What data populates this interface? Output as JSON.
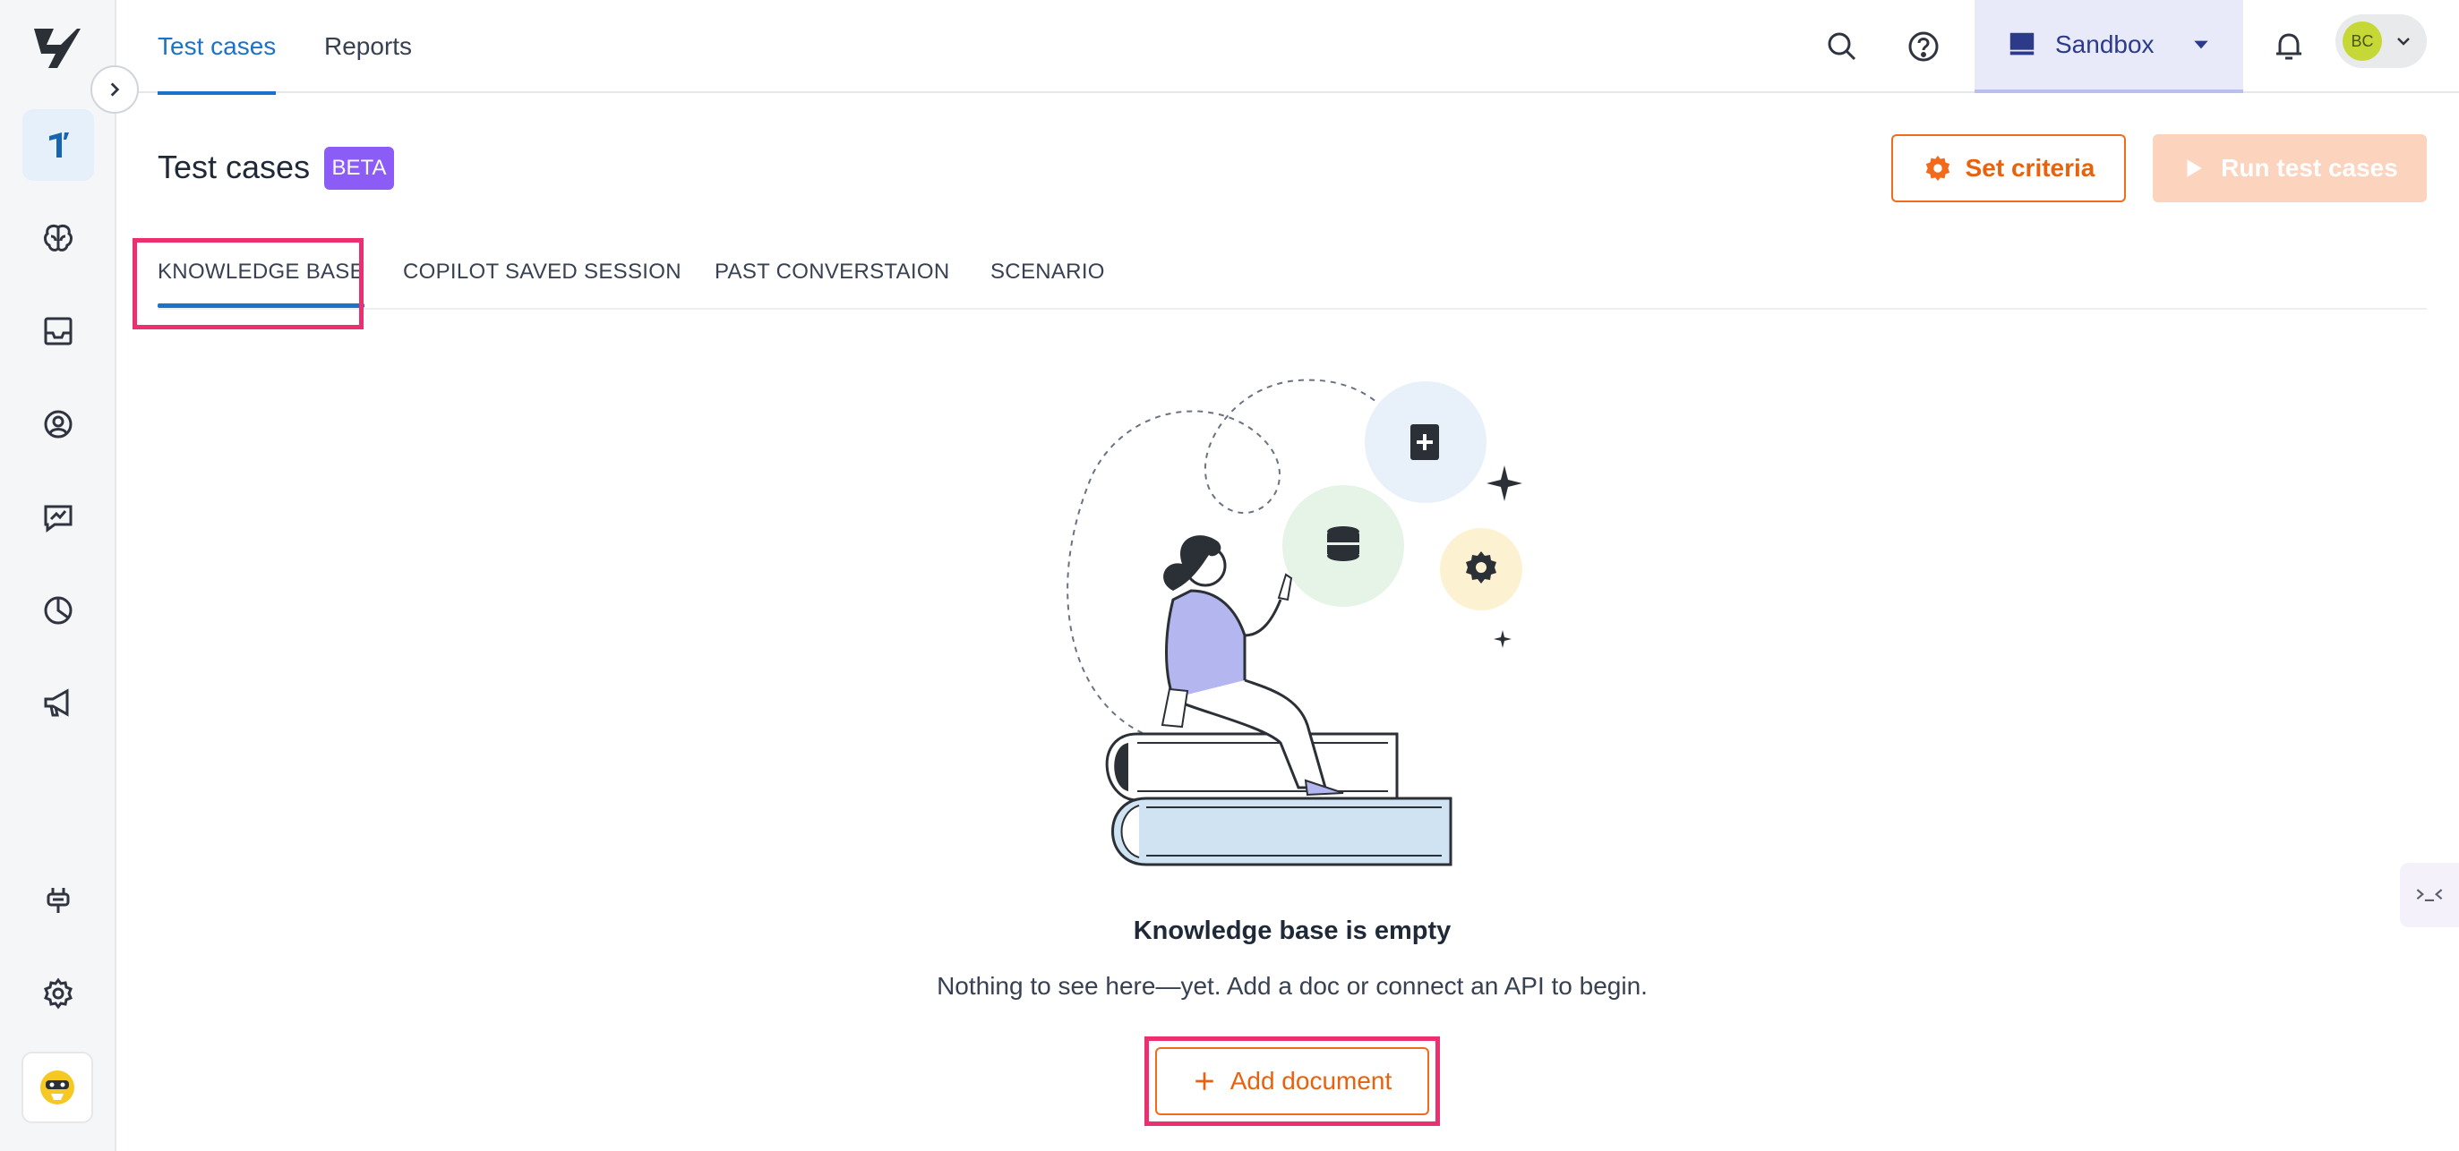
{
  "topbar": {
    "tabs": [
      {
        "label": "Test cases",
        "active": true
      },
      {
        "label": "Reports",
        "active": false
      }
    ],
    "workspace": "Sandbox",
    "avatar_initials": "BC"
  },
  "sidebar": {
    "items": [
      {
        "icon": "bot-one-icon",
        "active": true
      },
      {
        "icon": "brain-icon"
      },
      {
        "icon": "inbox-icon"
      },
      {
        "icon": "contacts-icon"
      },
      {
        "icon": "analytics-icon"
      },
      {
        "icon": "reports-pie-icon"
      },
      {
        "icon": "campaign-icon"
      },
      {
        "icon": "integrations-icon"
      },
      {
        "icon": "settings-icon"
      }
    ]
  },
  "page": {
    "title": "Test cases",
    "badge": "BETA",
    "set_criteria_label": "Set criteria",
    "run_label": "Run test cases"
  },
  "subtabs": [
    {
      "label": "KNOWLEDGE BASE",
      "active": true
    },
    {
      "label": "COPILOT SAVED SESSION"
    },
    {
      "label": "PAST CONVERSTAION"
    },
    {
      "label": "SCENARIO"
    }
  ],
  "empty_state": {
    "title": "Knowledge base is empty",
    "subtitle": "Nothing to see here—yet. Add a doc or connect an API to begin.",
    "add_label": "Add document"
  },
  "colors": {
    "accent_blue": "#1a73c8",
    "accent_orange": "#f26b1d",
    "beta_purple": "#8b5cf6",
    "highlight": "#ec2f6e"
  }
}
